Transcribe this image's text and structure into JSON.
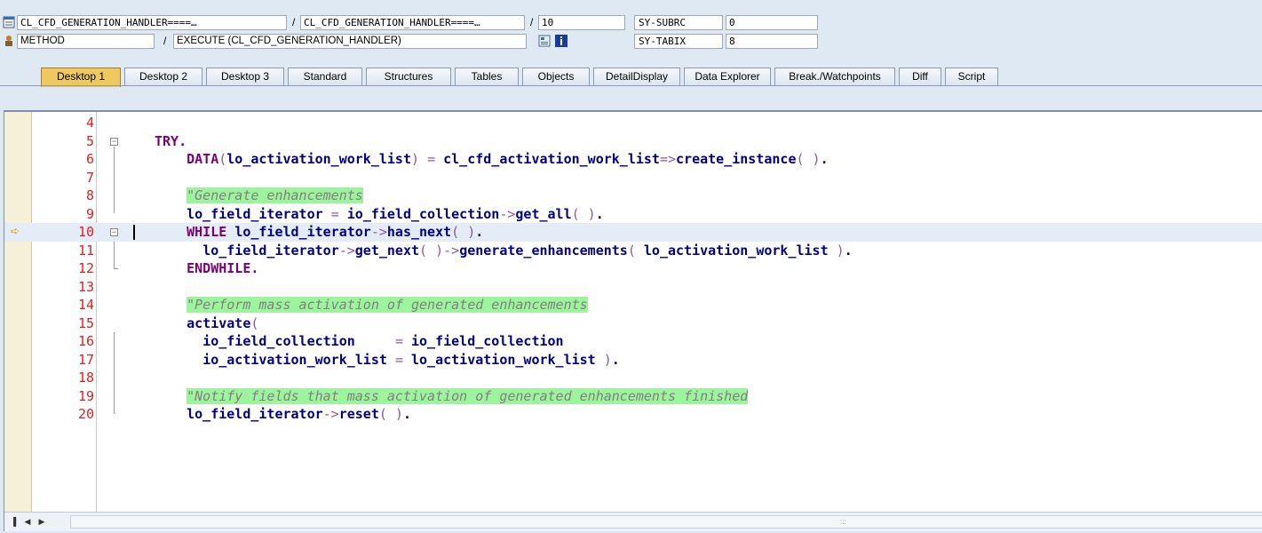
{
  "header": {
    "row1": {
      "program": "CL_CFD_GENERATION_HANDLER====…",
      "include": "CL_CFD_GENERATION_HANDLER====…",
      "line": "10",
      "var_name": "SY-SUBRC",
      "var_value": "0"
    },
    "row2": {
      "event_type": "METHOD",
      "event_name": "EXECUTE (CL_CFD_GENERATION_HANDLER)",
      "var_name": "SY-TABIX",
      "var_value": "8"
    },
    "separator": "/"
  },
  "tabs": [
    {
      "label": "Desktop 1",
      "active": true
    },
    {
      "label": "Desktop 2"
    },
    {
      "label": "Desktop 3"
    },
    {
      "label": "Standard"
    },
    {
      "label": "Structures"
    },
    {
      "label": "Tables"
    },
    {
      "label": "Objects"
    },
    {
      "label": "DetailDisplay"
    },
    {
      "label": "Data Explorer"
    },
    {
      "label": "Break./Watchpoints"
    },
    {
      "label": "Diff"
    },
    {
      "label": "Script"
    }
  ],
  "editor": {
    "current_line": 10,
    "lines": [
      {
        "n": "4",
        "tokens": []
      },
      {
        "n": "5",
        "tokens": [
          [
            "kw",
            "TRY."
          ]
        ]
      },
      {
        "n": "6",
        "tokens": [
          [
            "sp",
            "    "
          ],
          [
            "kw",
            "DATA"
          ],
          [
            "op",
            "("
          ],
          [
            "id",
            "lo_activation_work_list"
          ],
          [
            "op",
            ")"
          ],
          [
            "sp",
            " "
          ],
          [
            "op",
            "="
          ],
          [
            "sp",
            " "
          ],
          [
            "id",
            "cl_cfd_activation_work_list"
          ],
          [
            "op",
            "=>"
          ],
          [
            "id",
            "create_instance"
          ],
          [
            "op",
            "( )"
          ],
          [
            "id",
            "."
          ]
        ]
      },
      {
        "n": "7",
        "tokens": []
      },
      {
        "n": "8",
        "tokens": [
          [
            "sp",
            "    "
          ],
          [
            "cm",
            "\"Generate enhancements"
          ]
        ]
      },
      {
        "n": "9",
        "tokens": [
          [
            "sp",
            "    "
          ],
          [
            "id",
            "lo_field_iterator"
          ],
          [
            "sp",
            " "
          ],
          [
            "op",
            "="
          ],
          [
            "sp",
            " "
          ],
          [
            "id",
            "io_field_collection"
          ],
          [
            "op",
            "->"
          ],
          [
            "id",
            "get_all"
          ],
          [
            "op",
            "( )"
          ],
          [
            "id",
            "."
          ]
        ]
      },
      {
        "n": "10",
        "tokens": [
          [
            "sp",
            "    "
          ],
          [
            "kw",
            "WHILE"
          ],
          [
            "sp",
            " "
          ],
          [
            "id",
            "lo_field_iterator"
          ],
          [
            "op",
            "->"
          ],
          [
            "id",
            "has_next"
          ],
          [
            "op",
            "( )"
          ],
          [
            "id",
            "."
          ]
        ]
      },
      {
        "n": "11",
        "tokens": [
          [
            "sp",
            "      "
          ],
          [
            "id",
            "lo_field_iterator"
          ],
          [
            "op",
            "->"
          ],
          [
            "id",
            "get_next"
          ],
          [
            "op",
            "( )->"
          ],
          [
            "id",
            "generate_enhancements"
          ],
          [
            "op",
            "( "
          ],
          [
            "id",
            "lo_activation_work_list"
          ],
          [
            "op",
            " )"
          ],
          [
            "id",
            "."
          ]
        ]
      },
      {
        "n": "12",
        "tokens": [
          [
            "sp",
            "    "
          ],
          [
            "kw",
            "ENDWHILE."
          ]
        ]
      },
      {
        "n": "13",
        "tokens": []
      },
      {
        "n": "14",
        "tokens": [
          [
            "sp",
            "    "
          ],
          [
            "cm",
            "\"Perform mass activation of generated enhancements"
          ]
        ]
      },
      {
        "n": "15",
        "tokens": [
          [
            "sp",
            "    "
          ],
          [
            "id",
            "activate"
          ],
          [
            "op",
            "("
          ]
        ]
      },
      {
        "n": "16",
        "tokens": [
          [
            "sp",
            "      "
          ],
          [
            "id",
            "io_field_collection"
          ],
          [
            "sp",
            "     "
          ],
          [
            "op",
            "="
          ],
          [
            "sp",
            " "
          ],
          [
            "id",
            "io_field_collection"
          ]
        ]
      },
      {
        "n": "17",
        "tokens": [
          [
            "sp",
            "      "
          ],
          [
            "id",
            "io_activation_work_list"
          ],
          [
            "sp",
            " "
          ],
          [
            "op",
            "="
          ],
          [
            "sp",
            " "
          ],
          [
            "id",
            "lo_activation_work_list"
          ],
          [
            "op",
            " )"
          ],
          [
            "id",
            "."
          ]
        ]
      },
      {
        "n": "18",
        "tokens": []
      },
      {
        "n": "19",
        "tokens": [
          [
            "sp",
            "    "
          ],
          [
            "cm",
            "\"Notify fields that mass activation of generated enhancements finished"
          ]
        ]
      },
      {
        "n": "20",
        "tokens": [
          [
            "sp",
            "    "
          ],
          [
            "id",
            "lo_field_iterator"
          ],
          [
            "op",
            "->"
          ],
          [
            "id",
            "reset"
          ],
          [
            "op",
            "( )"
          ],
          [
            "id",
            "."
          ]
        ]
      }
    ]
  },
  "colors": {
    "keyword": "#7a007a",
    "identifier": "#000080",
    "operator": "#8a5aa0",
    "comment_bg": "#9cf59c",
    "line_number": "#e02020",
    "active_tab": "#f0c860"
  }
}
